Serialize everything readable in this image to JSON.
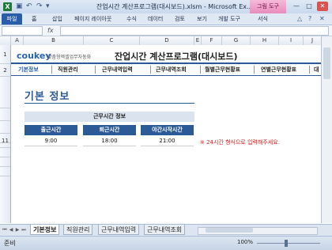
{
  "window": {
    "title": "잔업시간 계산프로그램(대시보드).xlsm - Microsoft Ex...",
    "context_tab": "그림 도구",
    "minimize": "—",
    "maximize": "□",
    "close": "✕"
  },
  "ribbon": {
    "file": "파일",
    "tabs": [
      "홈",
      "삽입",
      "페이지 레이아웃",
      "수식",
      "데이터",
      "검토",
      "보기",
      "개발 도구",
      "서식"
    ]
  },
  "formula_bar": {
    "fx": "fx",
    "name_box": ""
  },
  "columns": [
    "A",
    "B",
    "C",
    "D",
    "E",
    "F",
    "G",
    "H",
    "I",
    "J"
  ],
  "rows": [
    "1",
    "2",
    "",
    "",
    "",
    "",
    "",
    "",
    "",
    "",
    "11"
  ],
  "header": {
    "logo": "coukey",
    "logo_sub": "맞춤형엑셀업무자동화",
    "title": "잔업시간 계산프로그램(대시보드)"
  },
  "nav": [
    "기본정보",
    "직원관리",
    "근무내역입력",
    "근무내역조회",
    "월별근무현황표",
    "연별근무현황표",
    "대"
  ],
  "section": {
    "title": "기본 정보",
    "table_title": "근무시간 정보",
    "headers": [
      "출근시간",
      "퇴근시간",
      "야간시작시간"
    ],
    "values": [
      "9:00",
      "18:00",
      "21:00"
    ],
    "note": "※ 24시간 형식으로 입력해주세요."
  },
  "sheet_tabs": [
    "기본정보",
    "직원관리",
    "근무내역입력",
    "근무내역조회"
  ],
  "status": {
    "ready": "준비",
    "zoom": "100%"
  },
  "colors": {
    "accent": "#2c5a97",
    "note": "#e02020"
  }
}
